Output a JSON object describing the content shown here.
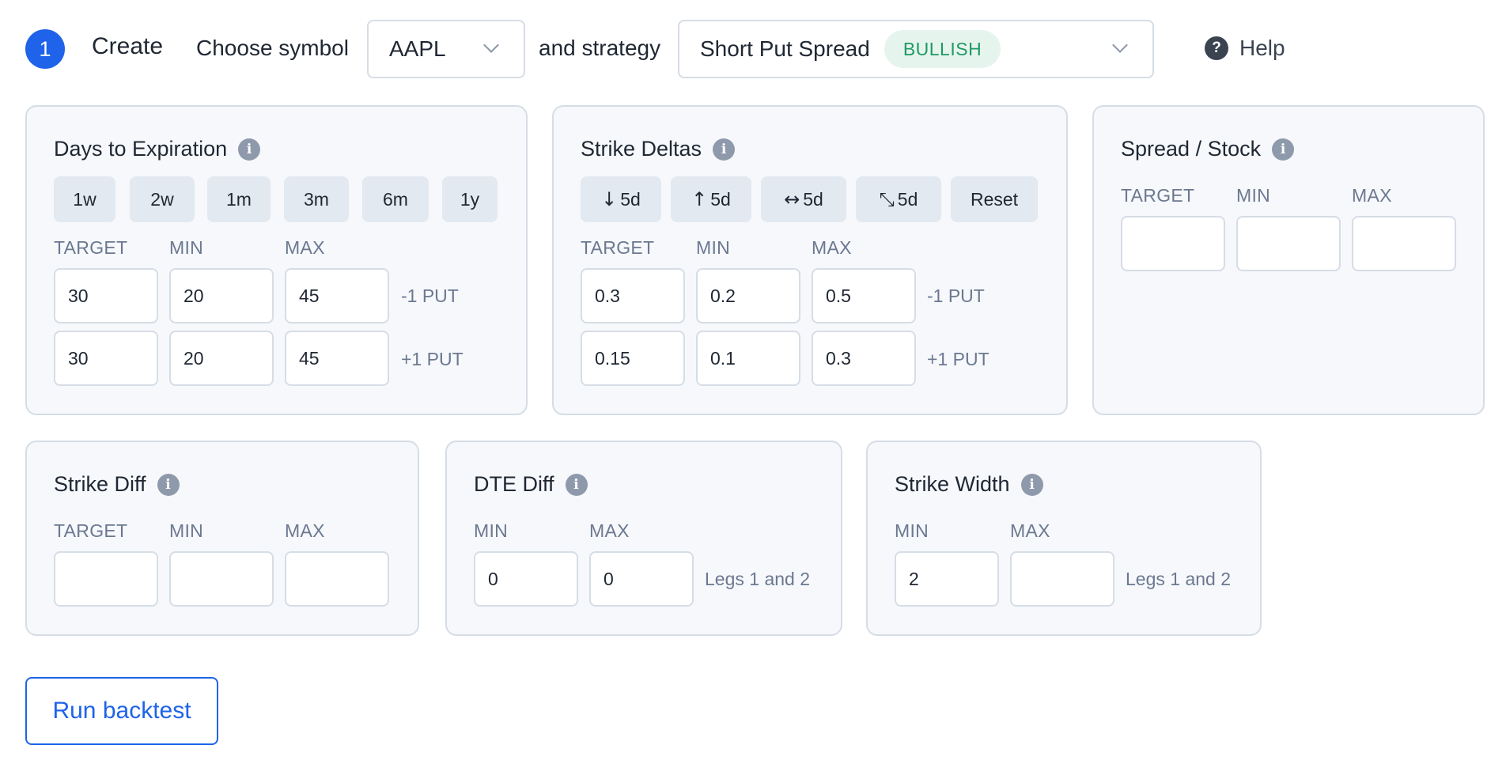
{
  "header": {
    "step_number": "1",
    "create_label": "Create",
    "choose_symbol_label": "Choose symbol",
    "symbol_value": "AAPL",
    "and_strategy_label": "and strategy",
    "strategy_value": "Short Put Spread",
    "strategy_badge": "BULLISH",
    "help_label": "Help",
    "help_icon": "?"
  },
  "days_to_expiration": {
    "title": "Days to Expiration",
    "info_icon": "i",
    "presets": [
      "1w",
      "2w",
      "1m",
      "3m",
      "6m",
      "1y"
    ],
    "columns": [
      "TARGET",
      "MIN",
      "MAX"
    ],
    "rows": [
      {
        "target": "30",
        "min": "20",
        "max": "45",
        "note": "-1 PUT"
      },
      {
        "target": "30",
        "min": "20",
        "max": "45",
        "note": "+1 PUT"
      }
    ]
  },
  "strike_deltas": {
    "title": "Strike Deltas",
    "info_icon": "i",
    "buttons": [
      {
        "icon": "arrow-down-icon",
        "glyph": "↓",
        "label": "5d"
      },
      {
        "icon": "arrow-up-icon",
        "glyph": "↑",
        "label": "5d"
      },
      {
        "icon": "arrow-left-right-icon",
        "glyph": "↔",
        "label": "5d"
      },
      {
        "icon": "arrows-collapse-icon",
        "glyph": "⤡",
        "label": "5d"
      }
    ],
    "reset_label": "Reset",
    "columns": [
      "TARGET",
      "MIN",
      "MAX"
    ],
    "rows": [
      {
        "target": "0.3",
        "min": "0.2",
        "max": "0.5",
        "note": "-1 PUT"
      },
      {
        "target": "0.15",
        "min": "0.1",
        "max": "0.3",
        "note": "+1 PUT"
      }
    ]
  },
  "spread_stock": {
    "title": "Spread / Stock",
    "info_icon": "i",
    "columns": [
      "TARGET",
      "MIN",
      "MAX"
    ],
    "values": {
      "target": "",
      "min": "",
      "max": ""
    }
  },
  "strike_diff": {
    "title": "Strike Diff",
    "info_icon": "i",
    "columns": [
      "TARGET",
      "MIN",
      "MAX"
    ],
    "values": {
      "target": "",
      "min": "",
      "max": ""
    }
  },
  "dte_diff": {
    "title": "DTE Diff",
    "info_icon": "i",
    "columns": [
      "MIN",
      "MAX"
    ],
    "values": {
      "min": "0",
      "max": "0"
    },
    "note": "Legs 1 and 2"
  },
  "strike_width": {
    "title": "Strike Width",
    "info_icon": "i",
    "columns": [
      "MIN",
      "MAX"
    ],
    "values": {
      "min": "2",
      "max": ""
    },
    "note": "Legs 1 and 2"
  },
  "actions": {
    "run_label": "Run backtest"
  },
  "colors": {
    "accent": "#1e63e9",
    "bullish_text": "#1f9a63",
    "bullish_bg": "#e6f4ee",
    "card_bg": "#f6f8fb",
    "border": "#d6dde6"
  }
}
